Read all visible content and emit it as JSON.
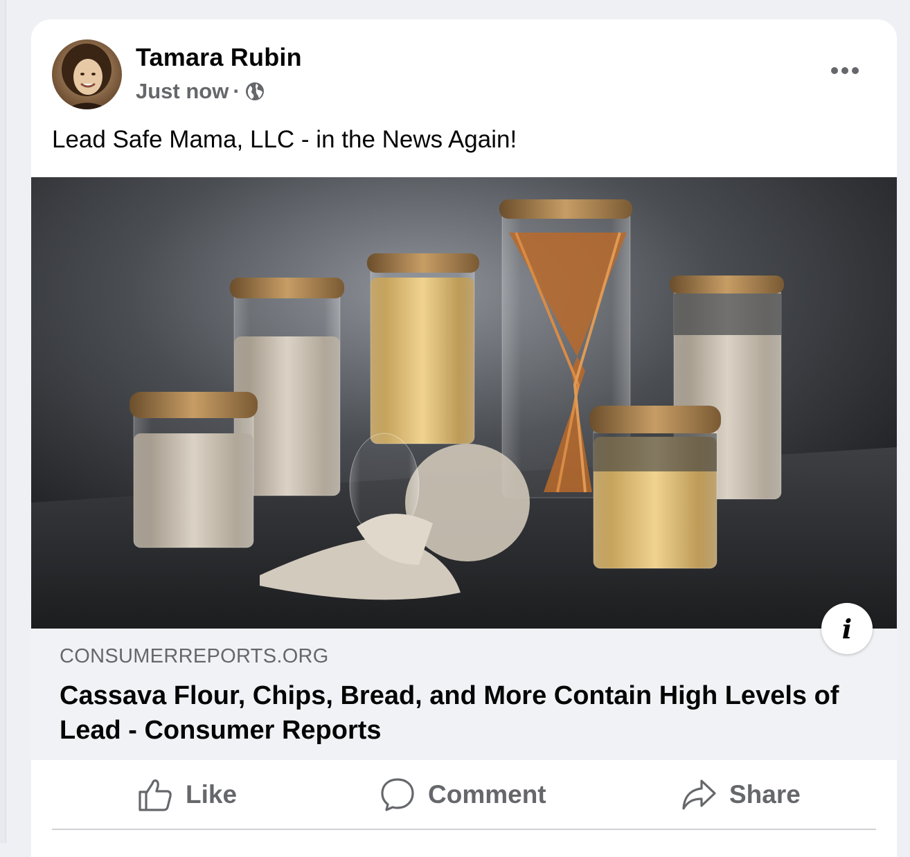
{
  "post": {
    "author": "Tamara Rubin",
    "timestamp": "Just now",
    "separator": "·",
    "audience_icon": "globe-icon",
    "text": "Lead Safe Mama, LLC - in the News Again!"
  },
  "link": {
    "domain": "CONSUMERREPORTS.ORG",
    "title": "Cassava Flour, Chips, Bread, and More Contain High Levels of Lead - Consumer Reports",
    "info_icon": "i"
  },
  "actions": {
    "like": "Like",
    "comment": "Comment",
    "share": "Share"
  },
  "colors": {
    "page_bg": "#eef0f4",
    "card_bg": "#ffffff",
    "preview_bg": "#f0f2f5",
    "secondary_text": "#65676b",
    "primary_text": "#050505"
  }
}
